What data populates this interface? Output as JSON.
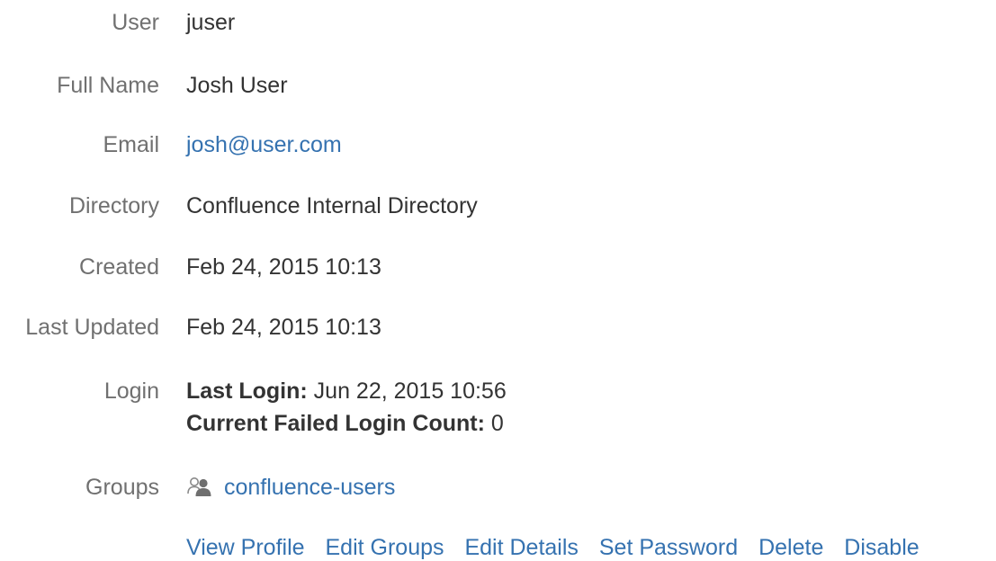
{
  "user": {
    "label": "User",
    "value": "juser"
  },
  "full_name": {
    "label": "Full Name",
    "value": "Josh User"
  },
  "email": {
    "label": "Email",
    "value": "josh@user.com"
  },
  "directory": {
    "label": "Directory",
    "value": "Confluence Internal Directory"
  },
  "created": {
    "label": "Created",
    "value": "Feb 24, 2015 10:13"
  },
  "last_updated": {
    "label": "Last Updated",
    "value": "Feb 24, 2015 10:13"
  },
  "login": {
    "label": "Login",
    "last_login_label": "Last Login:",
    "last_login_value": " Jun 22, 2015 10:56",
    "failed_count_label": "Current Failed Login Count:",
    "failed_count_value": " 0"
  },
  "groups": {
    "label": "Groups",
    "icon": "group-icon",
    "items": [
      "confluence-users"
    ]
  },
  "actions": [
    "View Profile",
    "Edit Groups",
    "Edit Details",
    "Set Password",
    "Delete",
    "Disable"
  ],
  "colors": {
    "link": "#3572b0",
    "label": "#707070",
    "text": "#333333"
  }
}
